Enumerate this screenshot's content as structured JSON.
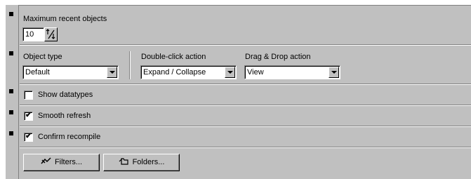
{
  "recent": {
    "label": "Maximum recent objects",
    "value": "10"
  },
  "object_type": {
    "label": "Object type",
    "value": "Default"
  },
  "double_click": {
    "label": "Double-click action",
    "value": "Expand / Collapse"
  },
  "drag_drop": {
    "label": "Drag & Drop action",
    "value": "View"
  },
  "show_datatypes": {
    "label": "Show datatypes",
    "checked": false
  },
  "smooth_refresh": {
    "label": "Smooth refresh",
    "checked": true
  },
  "confirm_recompile": {
    "label": "Confirm recompile",
    "checked": true
  },
  "check_glyph": "✔",
  "buttons": {
    "filters": "Filters...",
    "folders": "Folders..."
  },
  "icons": {
    "spin": "up-down-arrows-icon",
    "filters": "funnel-arrow-icon",
    "folders": "folder-arrow-icon"
  }
}
